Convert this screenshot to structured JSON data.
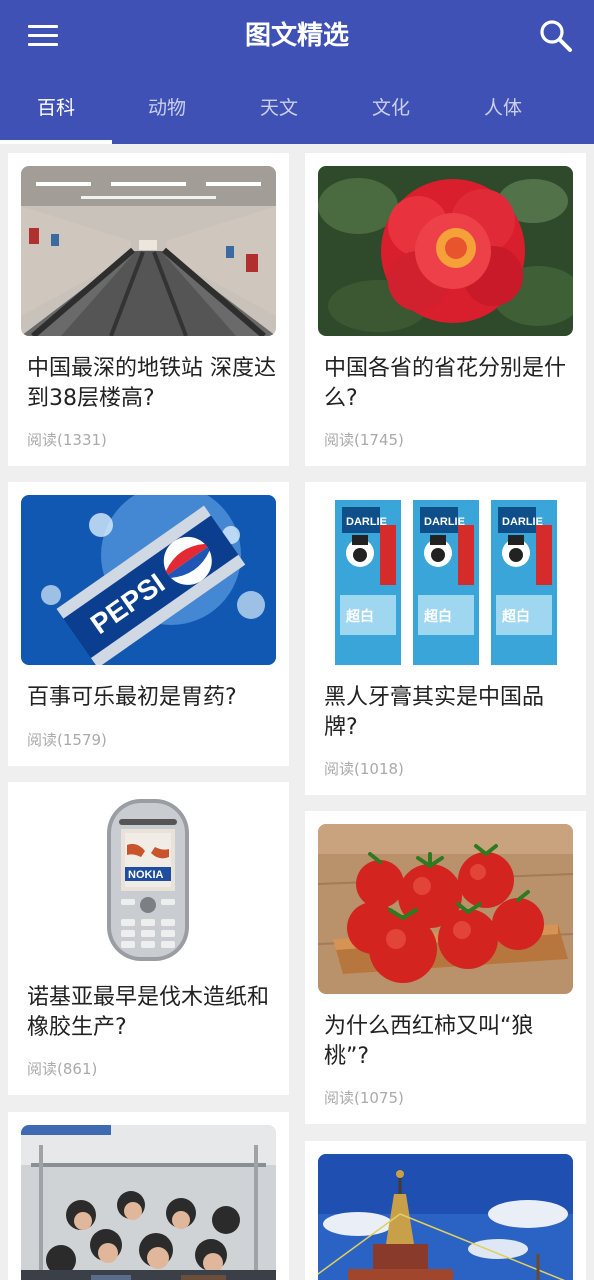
{
  "header": {
    "title": "图文精选",
    "menu_icon": "menu-icon",
    "search_icon": "search-icon"
  },
  "colors": {
    "primary": "#3f51b5",
    "tab_active": "#ffffff",
    "tab_inactive": "#c5cae9",
    "background": "#efefef",
    "read_count": "#aaaaaa"
  },
  "tabs": [
    {
      "label": "百科",
      "active": true
    },
    {
      "label": "动物",
      "active": false
    },
    {
      "label": "天文",
      "active": false
    },
    {
      "label": "文化",
      "active": false
    },
    {
      "label": "人体",
      "active": false
    }
  ],
  "articles": [
    {
      "title": "中国最深的地铁站 深度达到38层楼高?",
      "reads": "阅读(1331)",
      "image": "subway-escalator-photo"
    },
    {
      "title": "中国各省的省花分别是什么?",
      "reads": "阅读(1745)",
      "image": "red-rose-photo"
    },
    {
      "title": "百事可乐最初是胃药?",
      "reads": "阅读(1579)",
      "image": "pepsi-can-photo"
    },
    {
      "title": "黑人牙膏其实是中国品牌?",
      "reads": "阅读(1018)",
      "image": "darlie-toothpaste-photo"
    },
    {
      "title": "诺基亚最早是伐木造纸和橡胶生产?",
      "reads": "阅读(861)",
      "image": "nokia-phone-photo"
    },
    {
      "title": "为什么西红柿又叫“狼桃”?",
      "reads": "阅读(1075)",
      "image": "tomatoes-photo"
    },
    {
      "title": "",
      "reads": "",
      "image": "crowded-bus-photo"
    },
    {
      "title": "",
      "reads": "",
      "image": "tibetan-stupa-photo"
    }
  ]
}
